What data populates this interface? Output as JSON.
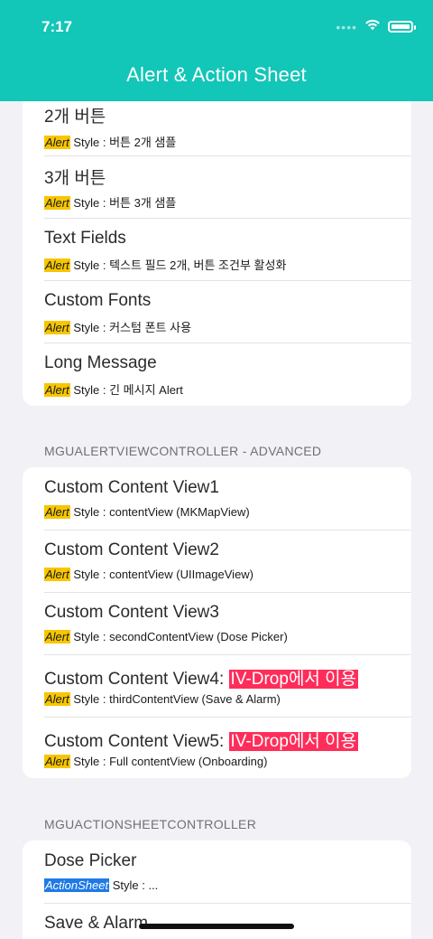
{
  "status": {
    "time": "7:17"
  },
  "nav": {
    "title": "Alert & Action Sheet"
  },
  "card1": [
    {
      "title": "2개 버튼",
      "tag": "Alert",
      "sub": " Style : 버튼 2개 샘플"
    },
    {
      "title": "3개 버튼",
      "tag": "Alert",
      "sub": " Style : 버튼 3개 샘플"
    },
    {
      "title": "Text Fields",
      "tag": "Alert",
      "sub": " Style : 텍스트 필드 2개, 버튼 조건부 활성화"
    },
    {
      "title": "Custom Fonts",
      "tag": "Alert",
      "sub": " Style : 커스텀 폰트 사용"
    },
    {
      "title": "Long Message",
      "tag": "Alert",
      "sub": " Style : 긴 메시지 Alert"
    }
  ],
  "section2": {
    "title": "MGUALERTVIEWCONTROLLER - ADVANCED"
  },
  "card2": [
    {
      "title": "Custom Content View1",
      "badge": "",
      "tag": "Alert",
      "sub": " Style : contentView (MKMapView)"
    },
    {
      "title": "Custom Content View2",
      "badge": "",
      "tag": "Alert",
      "sub": " Style : contentView (UIImageView)"
    },
    {
      "title": "Custom Content View3",
      "badge": "",
      "tag": "Alert",
      "sub": " Style : secondContentView (Dose Picker)"
    },
    {
      "title": "Custom Content View4: ",
      "badge": "IV-Drop에서 이용",
      "tag": "Alert",
      "sub": " Style : thirdContentView (Save & Alarm)"
    },
    {
      "title": "Custom Content View5: ",
      "badge": "IV-Drop에서 이용",
      "tag": "Alert",
      "sub": " Style : Full contentView (Onboarding)"
    }
  ],
  "section3": {
    "title": "MGUACTIONSHEETCONTROLLER"
  },
  "card3": [
    {
      "title": "Dose Picker",
      "tag": "ActionSheet",
      "sub": " Style : ..."
    },
    {
      "title": "Save & Alarm",
      "tag": "",
      "sub": ""
    }
  ],
  "colors": {
    "header": "#12c6b8",
    "alert_tag": "#f7c600",
    "actionsheet_tag": "#1f7ae6",
    "badge": "#ff2d5a"
  },
  "icons": [
    "wifi-icon",
    "battery-icon"
  ]
}
